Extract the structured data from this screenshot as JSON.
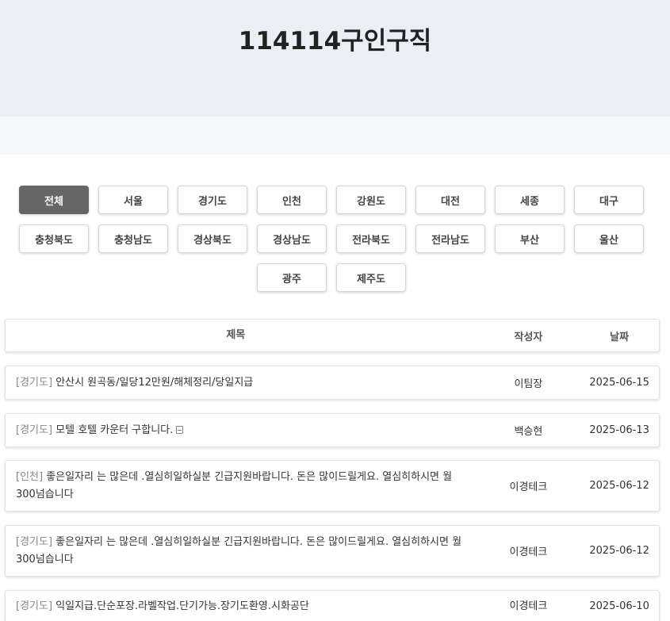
{
  "site": {
    "title": "114114구인구직"
  },
  "regions": [
    {
      "label": "전체",
      "active": true
    },
    {
      "label": "서울"
    },
    {
      "label": "경기도"
    },
    {
      "label": "인천"
    },
    {
      "label": "강원도"
    },
    {
      "label": "대전"
    },
    {
      "label": "세종"
    },
    {
      "label": "대구"
    },
    {
      "label": "충청북도"
    },
    {
      "label": "충청남도"
    },
    {
      "label": "경상북도"
    },
    {
      "label": "경상남도"
    },
    {
      "label": "전라북도"
    },
    {
      "label": "전라남도"
    },
    {
      "label": "부산"
    },
    {
      "label": "울산"
    },
    {
      "label": "광주"
    },
    {
      "label": "제주도"
    }
  ],
  "table": {
    "headers": {
      "title": "제목",
      "author": "작성자",
      "date": "날짜"
    },
    "rows": [
      {
        "region": "[경기도]",
        "title": "안산시 원곡동/일당12만원/해체정리/당일지급",
        "author": "이팀장",
        "date": "2025-06-15",
        "attachment": false
      },
      {
        "region": "[경기도]",
        "title": "모텔 호텔 카운터 구합니다.",
        "author": "백승현",
        "date": "2025-06-13",
        "attachment": true
      },
      {
        "region": "[인천]",
        "title": "좋은일자리 는 많은데 .열심히일하실분 긴급지원바랍니다. 돈은 많이드릴게요. 열심히하시면 월300넘습니다",
        "author": "이경테크",
        "date": "2025-06-12",
        "attachment": false
      },
      {
        "region": "[경기도]",
        "title": "좋은일자리 는 많은데 .열심히일하실분 긴급지원바랍니다. 돈은 많이드릴게요. 열심히하시면 월300넘습니다",
        "author": "이경테크",
        "date": "2025-06-12",
        "attachment": false
      },
      {
        "region": "[경기도]",
        "title": "익일지급.단순포장.라벨작업.단기가능.장기도환영.시화공단",
        "author": "이경테크",
        "date": "2025-06-10",
        "attachment": false
      }
    ]
  }
}
